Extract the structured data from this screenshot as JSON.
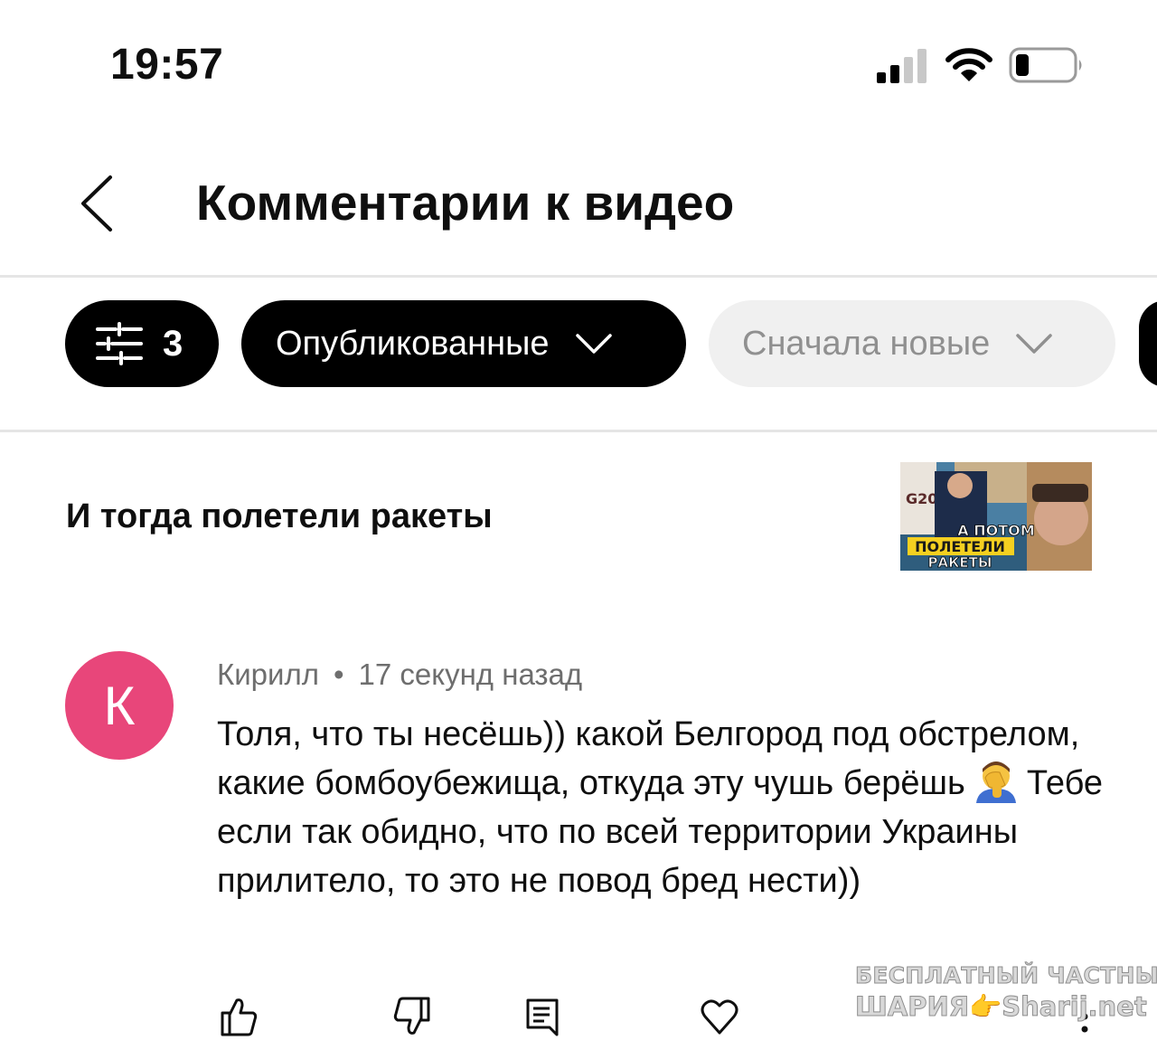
{
  "status_bar": {
    "time": "19:57",
    "icons": [
      "signal-icon",
      "wifi-icon",
      "battery-icon"
    ]
  },
  "header": {
    "back_icon": "chevron-left-icon",
    "title": "Комментарии к видео"
  },
  "filters": {
    "filter_icon": "sliders-icon",
    "filter_count": "3",
    "status_label": "Опубликованные",
    "sort_label": "Сначала новые"
  },
  "video": {
    "title": "И тогда полетели ракеты",
    "thumbnail_text": {
      "logo": "G20",
      "line1": "А ПОТОМ",
      "line2": "ПОЛЕТЕЛИ",
      "line3": "РАКЕТЫ"
    }
  },
  "comment": {
    "avatar_letter": "К",
    "author": "Кирилл",
    "separator": "•",
    "time_ago": "17 секунд назад",
    "text_before_emoji": "Толя, что ты несёшь)) какой Белгород под обстрелом, какие бомбоубежища, откуда эту чушь берёшь",
    "emoji": "facepalm-emoji",
    "text_after_emoji": "Тебе если так обидно, что по всей территории Украины прилитело, то это не повод бред нести))",
    "actions": [
      "like-icon",
      "dislike-icon",
      "reply-icon",
      "heart-icon",
      "more-icon"
    ]
  },
  "watermark": {
    "line1": "БЕСПЛАТНЫЙ ЧАСТНЫЙ",
    "line2": "ШАРИЯ👉Sharij.net"
  },
  "colors": {
    "avatar": "#e8467a",
    "chip_dark": "#000000",
    "chip_light": "#f0f0f0",
    "muted_text": "#6e6e6e"
  }
}
